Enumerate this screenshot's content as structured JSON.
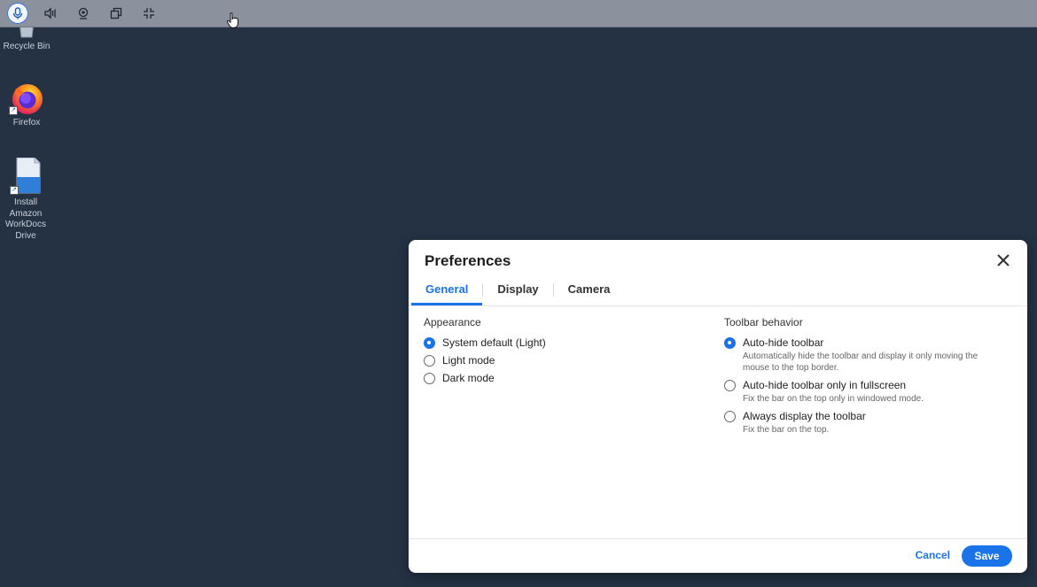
{
  "toolbar": {
    "buttons": [
      {
        "icon": "microphone-icon",
        "active": true
      },
      {
        "icon": "speaker-icon",
        "active": false
      },
      {
        "icon": "webcam-icon",
        "active": false
      },
      {
        "icon": "multi-window-icon",
        "active": false
      },
      {
        "icon": "exit-fullscreen-icon",
        "active": false
      }
    ]
  },
  "desktop": {
    "icons": [
      {
        "label": "Recycle Bin",
        "icon": "recycle-bin-icon"
      },
      {
        "label": "Firefox",
        "icon": "firefox-icon"
      },
      {
        "label": "Install Amazon WorkDocs Drive",
        "icon": "installer-icon"
      }
    ]
  },
  "dialog": {
    "title": "Preferences",
    "tabs": [
      "General",
      "Display",
      "Camera"
    ],
    "active_tab": "General",
    "appearance": {
      "title": "Appearance",
      "options": [
        {
          "label": "System default (Light)",
          "checked": true
        },
        {
          "label": "Light mode",
          "checked": false
        },
        {
          "label": "Dark mode",
          "checked": false
        }
      ]
    },
    "toolbar_behavior": {
      "title": "Toolbar behavior",
      "options": [
        {
          "label": "Auto-hide toolbar",
          "desc": "Automatically hide the toolbar and display it only moving the mouse to the top border.",
          "checked": true
        },
        {
          "label": "Auto-hide toolbar only in fullscreen",
          "desc": "Fix the bar on the top only in windowed mode.",
          "checked": false
        },
        {
          "label": "Always display the toolbar",
          "desc": "Fix the bar on the top.",
          "checked": false
        }
      ]
    },
    "cancel_label": "Cancel",
    "save_label": "Save"
  },
  "colors": {
    "desktop_bg": "#243244",
    "toolbar_bg": "#8b929e",
    "accent": "#1a73e8"
  }
}
